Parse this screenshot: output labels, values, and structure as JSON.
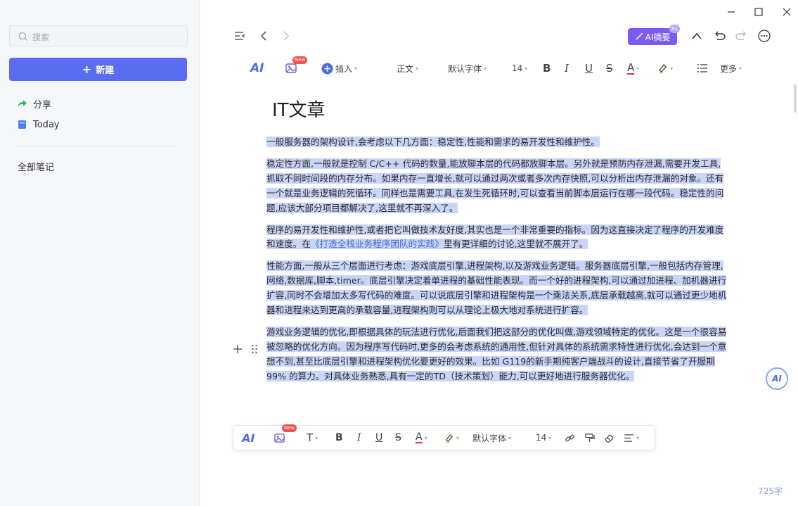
{
  "sidebar": {
    "search_placeholder": "搜索",
    "new_button": "新建",
    "items": [
      {
        "label": "分享",
        "icon": "share-arrow-icon"
      },
      {
        "label": "Today",
        "icon": "notebook-icon"
      }
    ],
    "all_notes": "全部笔记"
  },
  "header": {
    "ai_summary": "AI摘要",
    "r1_badge": "R1"
  },
  "toolbar": {
    "new_badge": "New",
    "insert": "插入",
    "paragraph_style": "正文",
    "font_family": "默认字体",
    "font_size": "14",
    "more": "更多"
  },
  "document": {
    "title": "IT文章",
    "p1": "一般服务器的架构设计,会考虑以下几方面：稳定性,性能和需求的易开发性和维护性。",
    "p2": "稳定性方面,一般就是控制 C/C++ 代码的数量,能放脚本层的代码都放脚本层。另外就是预防内存泄漏,需要开发工具,抓取不同时间段的内存分布。如果内存一直增长,就可以通过两次或者多次内存快照,可以分析出内存泄漏的对象。还有一个就是业务逻辑的死循环。同样也是需要工具,在发生死循环时,可以查看当前脚本层运行在哪一段代码。稳定性的问题,应该大部分项目都解决了,这里就不再深入了。",
    "p3_before": "程序的易开发性和维护性,或者把它叫做技术友好度,其实也是一个非常重要的指标。因为这直接决定了程序的开发难度和速度。在",
    "p3_link": "《打造全栈业务程序团队的实践》",
    "p3_after": "里有更详细的讨论,这里就不展开了。",
    "p4": "性能方面,一般从三个层面进行考虑：游戏底层引擎,进程架构,以及游戏业务逻辑。服务器底层引擎,一般包括内存管理,网络,数据库,脚本,timer。底层引擎决定着单进程的基础性能表现。而一个好的进程架构,可以通过加进程、加机器进行扩容,同时不会增加太多写代码的难度。可以说底层引擎和进程架构是一个乘法关系,底层承载越高,就可以通过更少地机器和进程来达到更高的承载容量,进程架构则可以从理论上极大地对系统进行扩容。",
    "p5": "游戏业务逻辑的优化,即根据具体的玩法进行优化,后面我们把这部分的优化叫做,游戏领域特定的优化。这是一个很容易被忽略的优化方向。因为程序写代码时,更多的会考虑系统的通用性,但针对具体的系统需求特性进行优化,会达到一个意想不到,甚至比底层引擎和进程架构优化要更好的效果。比如 G119的新手期纯客户端战斗的设计,直接节省了开服期 99% 的算力。对具体业务熟悉,具有一定的TD（技术策划）能力,可以更好地进行服务器优化。"
  },
  "float_toolbar": {
    "new_badge": "New",
    "font_family": "默认字体",
    "font_size": "14"
  },
  "footer": {
    "word_count": "725字"
  },
  "colors": {
    "accent": "#5a6cf0",
    "ai_purple": "#7c5cf0",
    "highlight": "#c9d5f8",
    "link": "#3f6bd8"
  }
}
